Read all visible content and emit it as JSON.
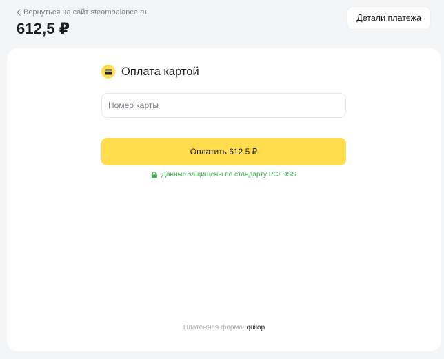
{
  "header": {
    "back_link": "Вернуться на сайт steambalance.ru",
    "amount": "612,5 ₽",
    "details_button": "Детали платежа"
  },
  "payment": {
    "title": "Оплата картой",
    "card_number_placeholder": "Номер карты",
    "card_number_value": "",
    "pay_button": "Оплатить 612.5 ₽",
    "security_note": "Данные защищены по стандарту PCI DSS"
  },
  "footer": {
    "label": "Платежная форма:",
    "brand": "quilop"
  },
  "colors": {
    "accent_yellow": "#ffdd4d",
    "secure_green": "#38b24a",
    "page_background": "#f4f5f7"
  },
  "icons": {
    "back": "chevron-left-icon",
    "card": "credit-card-icon",
    "secure": "lock-icon"
  }
}
